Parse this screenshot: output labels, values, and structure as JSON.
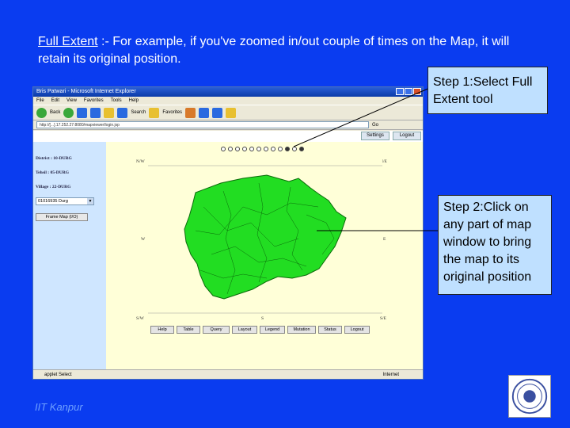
{
  "heading": {
    "term": "Full Extent",
    "text": " :- For example, if you've zoomed in/out couple of times on the Map, it will retain its original position."
  },
  "callouts": {
    "step1": "Step 1:Select Full Extent tool",
    "step2": "Step 2:Click on any part of map window to bring the map to its original position"
  },
  "footer": "IIT Kanpur",
  "browser": {
    "title": "Bris Patwari - Microsoft Internet Explorer",
    "menu": [
      "File",
      "Edit",
      "View",
      "Favorites",
      "Tools",
      "Help"
    ],
    "toolbar": {
      "back": "Back",
      "search": "Search",
      "favorites": "Favorites"
    },
    "address": "http://[...].17.252.27:8080/mapviewer/login.jsp",
    "go": "Go",
    "status_left": "applet Select",
    "status_right": "Internet"
  },
  "app": {
    "settings": "Settings",
    "logout_top": "Logout",
    "district": "District : 10-DURG",
    "tehsil": "Tehsil : 05-DURG",
    "village": "Village : 22-DURG",
    "village_select": "01016935 Durg",
    "select_button": "Frame Map (I/O)",
    "directions": {
      "nw": "N/W",
      "n": "N",
      "ne": "N/E",
      "w": "W",
      "e": "E",
      "sw": "S/W",
      "s": "S",
      "se": "S/E"
    },
    "buttons": [
      "Help",
      "Table",
      "Query",
      "Layout",
      "Legend",
      "Mutation",
      "Status",
      "Logout"
    ]
  },
  "colors": {
    "slide_bg": "#0a3cf0",
    "callout_bg": "#bfe0ff",
    "map_fill": "#22dd22",
    "map_panel": "#ffffd8"
  },
  "icons": [
    "zoom-in-icon",
    "zoom-out-icon",
    "pan-icon",
    "full-extent-icon",
    "identify-icon",
    "info-icon"
  ]
}
